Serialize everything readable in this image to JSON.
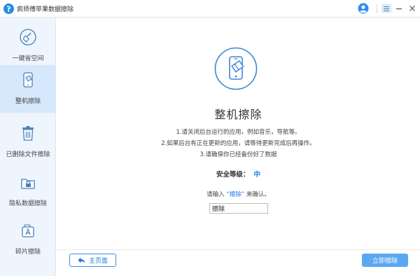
{
  "window": {
    "title": "疯师傅苹果数据擦除",
    "menu_icon": "hamburger-menu-icon",
    "minimize_icon": "minimize-icon",
    "close_icon": "close-icon",
    "avatar_icon": "user-avatar-icon"
  },
  "sidebar": {
    "items": [
      {
        "label": "一键省空间",
        "icon": "broom-icon",
        "active": false
      },
      {
        "label": "整机擦除",
        "icon": "phone-erase-icon",
        "active": true
      },
      {
        "label": "已删除文件擦除",
        "icon": "trash-icon",
        "active": false
      },
      {
        "label": "隐私数据擦除",
        "icon": "lock-folder-icon",
        "active": false
      },
      {
        "label": "碎片擦除",
        "icon": "app-fragment-icon",
        "active": false
      }
    ]
  },
  "main": {
    "hero_icon": "phone-eraser-icon",
    "title": "整机擦除",
    "instructions": [
      "1.请关闭后台运行的应用，例如音乐，导航等。",
      "2.如果后台有正在更新的应用，请等待更新完成后再操作。",
      "3.请确保你已经备份好了数据"
    ],
    "security_level_label": "安全等级：",
    "security_level_value": "中",
    "confirm_prefix": "请输入",
    "confirm_word": "“擦除”",
    "confirm_suffix": "来确认。",
    "confirm_input_value": "擦除"
  },
  "footer": {
    "home_label": "主页面",
    "home_icon": "back-arrow-icon",
    "erase_label": "立即擦除"
  },
  "colors": {
    "accent": "#1e7ae0",
    "sidebar_bg": "#eef5fd",
    "sidebar_active_bg": "#d6e8fb",
    "primary_button": "#5aa8f3"
  }
}
